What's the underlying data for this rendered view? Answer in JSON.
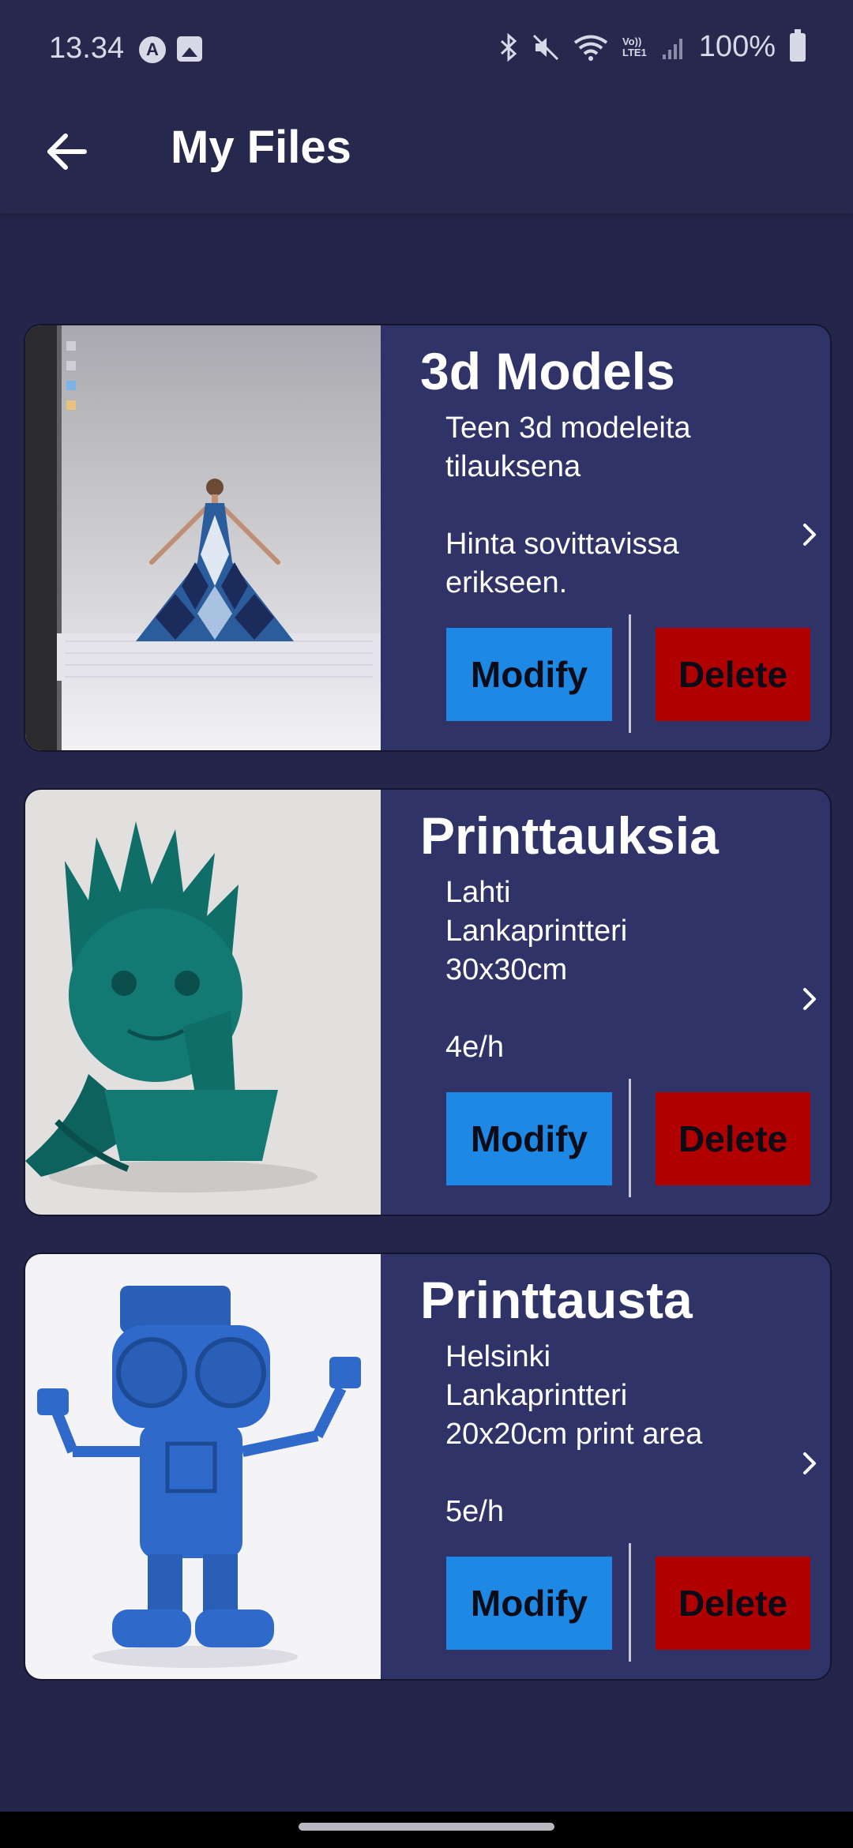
{
  "status_bar": {
    "time": "13.34",
    "left_icons": [
      "a-circle-icon",
      "image-icon"
    ],
    "right_icons": [
      "bluetooth-icon",
      "mute-icon",
      "wifi-icon",
      "volte-icon",
      "signal-icon"
    ],
    "volte_label": "Vo))\nLTE1",
    "battery": "100%"
  },
  "app_bar": {
    "back_icon": "arrow-left-icon",
    "title": "My Files"
  },
  "cards": [
    {
      "title": "3d Models",
      "description": "Teen 3d modeleita\ntilauksena\n\nHinta sovittavissa\nerikseen.",
      "image": "3d-dress-model-image",
      "modify_label": "Modify",
      "delete_label": "Delete"
    },
    {
      "title": "Printtauksia",
      "description": "Lahti\nLankaprintteri\n30x30cm\n\n4e/h",
      "image": "groot-print-image",
      "modify_label": "Modify",
      "delete_label": "Delete"
    },
    {
      "title": "Printtausta",
      "description": "Helsinki\nLankaprintteri\n20x20cm print area\n\n5e/h",
      "image": "robot-print-image",
      "modify_label": "Modify",
      "delete_label": "Delete"
    }
  ],
  "colors": {
    "background": "#24254a",
    "card_background": "#2f3368",
    "modify_button": "#1e88e5",
    "delete_button": "#b00000"
  }
}
